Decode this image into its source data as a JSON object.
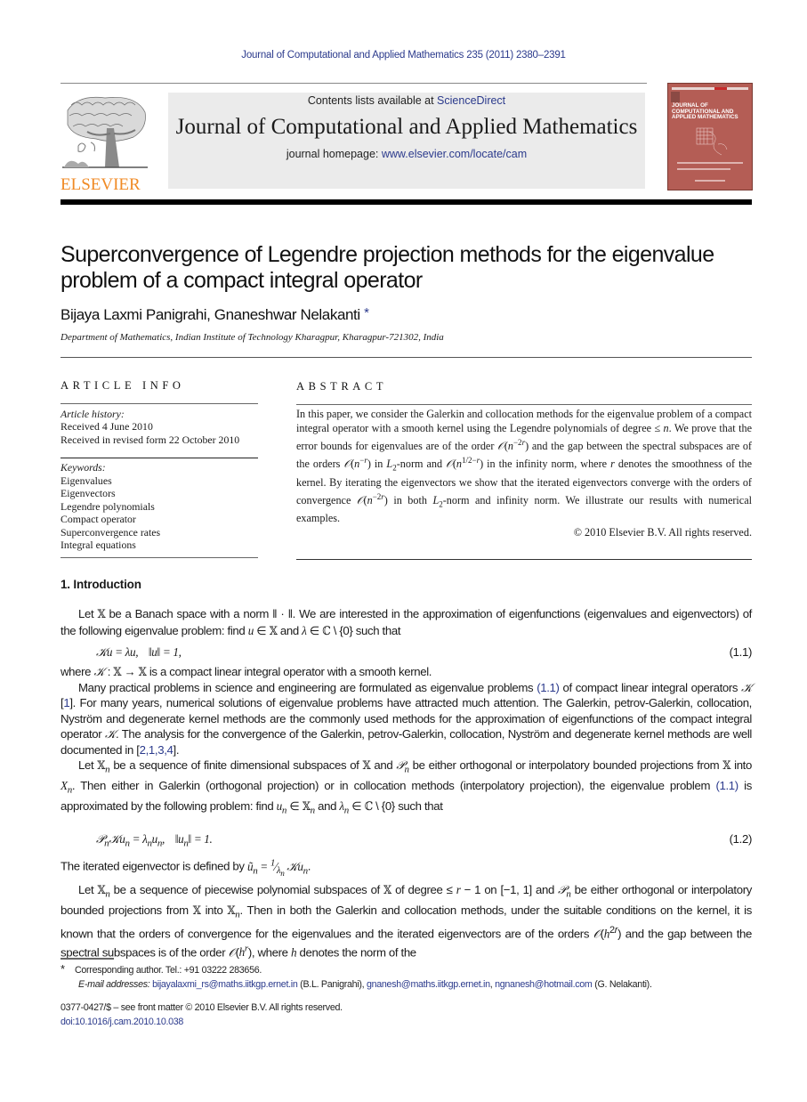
{
  "header": {
    "journal_ref": "Journal of Computational and Applied Mathematics 235 (2011) 2380–2391",
    "contents_prefix": "Contents lists available at ",
    "contents_link": "ScienceDirect",
    "journal_title": "Journal of Computational and Applied Mathematics",
    "homepage_prefix": "journal homepage: ",
    "homepage_link": "www.elsevier.com/locate/cam",
    "publisher_logo": "ELSEVIER",
    "cover_title": "JOURNAL OF COMPUTATIONAL AND APPLIED MATHEMATICS",
    "colors": {
      "link": "#2b3a8c",
      "elsevier_orange": "#f08a24",
      "cover": "#b45d55",
      "masthead_bg": "#ebebeb"
    }
  },
  "article": {
    "title": "Superconvergence of Legendre projection methods for the eigenvalue problem of a compact integral operator",
    "authors": "Bijaya Laxmi Panigrahi, Gnaneshwar Nelakanti",
    "author_mark": "*",
    "affiliation": "Department of Mathematics, Indian Institute of Technology Kharagpur, Kharagpur-721302, India"
  },
  "article_info": {
    "heading": "ARTICLE INFO",
    "history_label": "Article history:",
    "history": [
      "Received 4 June 2010",
      "Received in revised form 22 October 2010"
    ],
    "keywords_label": "Keywords:",
    "keywords": [
      "Eigenvalues",
      "Eigenvectors",
      "Legendre polynomials",
      "Compact operator",
      "Superconvergence rates",
      "Integral equations"
    ]
  },
  "abstract": {
    "heading": "ABSTRACT",
    "s1": "In this paper, we consider the Galerkin and collocation methods for the eigenvalue problem of a compact integral operator with a smooth kernel using the Legendre polynomials of degree ≤ ",
    "s2": ". We prove that the error bounds for eigenvalues are of the order ",
    "s3": " and the gap between the spectral subspaces are of the orders ",
    "s4": " in ",
    "s5": "-norm and ",
    "s6": " in the infinity norm, where ",
    "s7": " denotes the smoothness of the kernel. By iterating the eigenvectors we show that the iterated eigenvectors converge with the orders of convergence ",
    "s8": " in both ",
    "s9": "-norm and infinity norm. We illustrate our results with numerical examples.",
    "copyright": "© 2010 Elsevier B.V. All rights reserved."
  },
  "intro": {
    "heading": "1.  Introduction",
    "eq1_label": "(1.1)",
    "eq2_label": "(1.2)",
    "ref_1_1": "(1.1)",
    "cite1": "1",
    "cite2": "2,1,3,4",
    "p1a": "Let ",
    "p1b": " be a Banach space with a norm ‖ · ‖. We are interested in the approximation of eigenfunctions (eigenvalues and eigenvectors) of the following eigenvalue problem: find ",
    "p1c": " and ",
    "p1d": " such that",
    "p2a": "where ",
    "p2b": " is a compact linear integral operator with a smooth kernel.",
    "p3a": "Many practical problems in science and engineering are formulated as eigenvalue problems ",
    "p3b": " of compact linear integral operators ",
    "p3c": ". For many years, numerical solutions of eigenvalue problems have attracted much attention. The Galerkin, petrov-Galerkin, collocation, Nyström and degenerate kernel methods are the commonly used methods for the approximation of eigenfunctions of the compact integral operator ",
    "p3d": ". The analysis for the convergence of the Galerkin, petrov-Galerkin, collocation, Nyström and degenerate kernel methods are well documented in ",
    "p4a": " be a sequence of finite dimensional subspaces of ",
    "p4b": " be either orthogonal or interpolatory bounded projections from ",
    "p4c": ". Then either in Galerkin (orthogonal projection) or in collocation methods (interpolatory projection), the eigenvalue problem ",
    "p4d": " is approximated by the following problem: find ",
    "p4e": " such that",
    "p5": "The iterated eigenvector is defined by ",
    "p6a": " be a sequence of piecewise polynomial subspaces of ",
    "p6b": " of degree ≤ ",
    "p6c": " on [−1, 1] and ",
    "p6d": " be either orthogonal or interpolatory bounded projections from ",
    "p6e": ". Then in both the Galerkin and collocation methods, under the suitable conditions on the kernel, it is known that the orders of convergence for the eigenvalues and the iterated eigenvectors are of the orders ",
    "p6f": " and the gap between the spectral subspaces is of the order ",
    "p6g": ", where ",
    "p6h": " denotes the norm of the"
  },
  "footnote": {
    "mark": "*",
    "corresponding": "Corresponding author. Tel.: +91 03222 283656.",
    "email_label": "E-mail addresses: ",
    "email1": "bijayalaxmi_rs@maths.iitkgp.ernet.in",
    "email1_who": " (B.L. Panigrahi), ",
    "email2": "gnanesh@maths.iitkgp.ernet.in",
    "email3": "ngnanesh@hotmail.com",
    "email3_who": " (G. Nelakanti)."
  },
  "front_matter": {
    "issn": "0377-0427/$ – see front matter © 2010 Elsevier B.V. All rights reserved.",
    "doi": "doi:10.1016/j.cam.2010.10.038"
  }
}
